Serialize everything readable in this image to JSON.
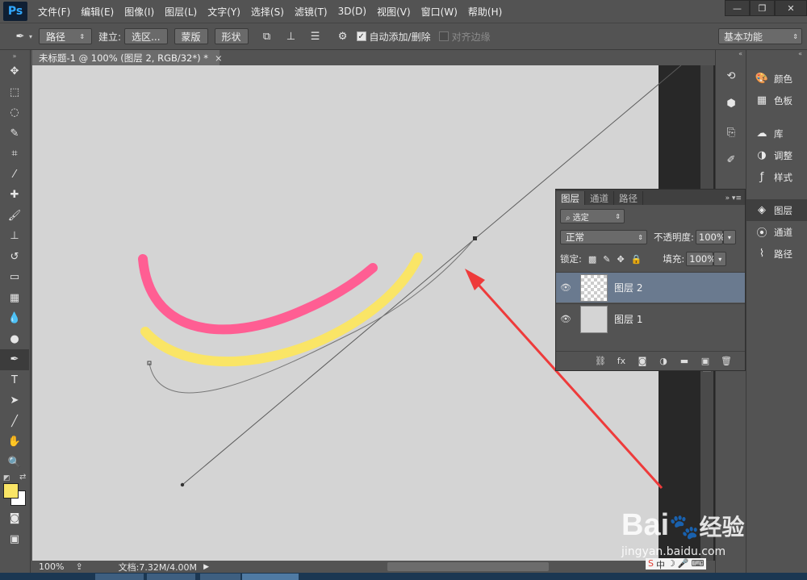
{
  "app": {
    "logo": "Ps"
  },
  "menu": [
    "文件(F)",
    "编辑(E)",
    "图像(I)",
    "图层(L)",
    "文字(Y)",
    "选择(S)",
    "滤镜(T)",
    "3D(D)",
    "视图(V)",
    "窗口(W)",
    "帮助(H)"
  ],
  "window_controls": {
    "minimize": "—",
    "restore": "❐",
    "close": "✕"
  },
  "options": {
    "tool_icon": "pen-icon",
    "mode": "路径",
    "make_label": "建立:",
    "selection_btn": "选区...",
    "mask_btn": "蒙版",
    "shape_btn": "形状",
    "auto_add_delete": "自动添加/删除",
    "auto_add_checked": true,
    "align_edges": "对齐边缘",
    "align_edges_checked": false,
    "workspace": "基本功能"
  },
  "document": {
    "tab_title": "未标题-1 @ 100% (图层 2, RGB/32*) *",
    "zoom": "100%",
    "doc_info": "文档:7.32M/4.00M"
  },
  "colors": {
    "pink_stroke": "#ff5e93",
    "yellow_stroke": "#fae566",
    "arrow": "#ee3b3b",
    "foreground": "#fae566",
    "background": "#ffffff"
  },
  "right_strip": {
    "items": [
      {
        "icon": "color-icon",
        "label": "颜色"
      },
      {
        "icon": "swatches-icon",
        "label": "色板"
      },
      {
        "icon": "libraries-icon",
        "label": "库"
      },
      {
        "icon": "adjustments-icon",
        "label": "调整"
      },
      {
        "icon": "styles-icon",
        "label": "样式"
      },
      {
        "icon": "layers-icon",
        "label": "图层"
      },
      {
        "icon": "channels-icon",
        "label": "通道"
      },
      {
        "icon": "paths-icon",
        "label": "路径"
      }
    ]
  },
  "layers_panel": {
    "tabs": [
      "图层",
      "通道",
      "路径"
    ],
    "filter": "选定",
    "blend_mode": "正常",
    "opacity_label": "不透明度:",
    "opacity": "100%",
    "lock_label": "锁定:",
    "fill_label": "填充:",
    "fill": "100%",
    "layers": [
      {
        "name": "图层 2",
        "selected": true
      },
      {
        "name": "图层 1",
        "selected": false
      }
    ]
  },
  "watermark": {
    "brand": "Bai",
    "brand2": "经验",
    "url": "jingyan.baidu.com"
  }
}
